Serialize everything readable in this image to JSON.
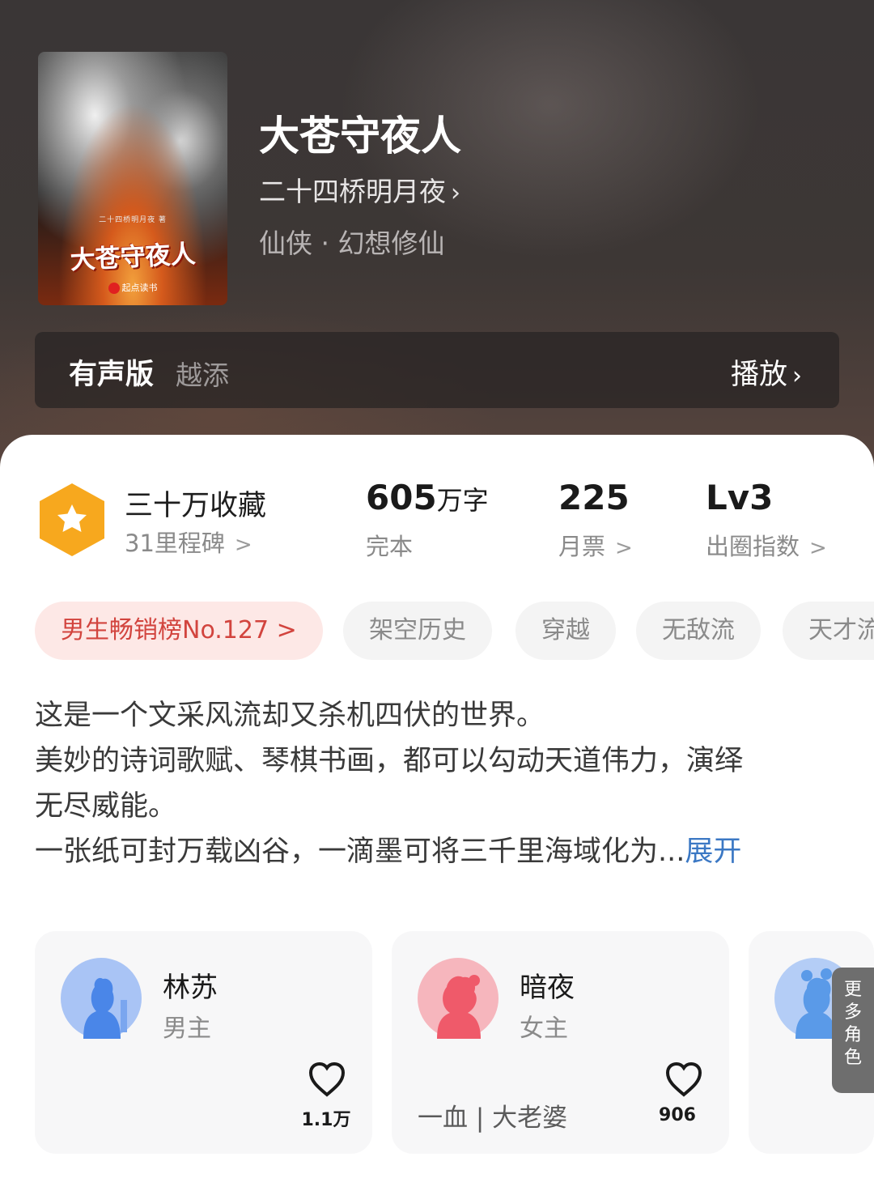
{
  "book": {
    "title": "大苍守夜人",
    "author": "二十四桥明月夜",
    "genre": "仙侠 · 幻想修仙",
    "cover": {
      "title_text": "大苍守夜人",
      "author_text": "二十四桥明月夜 著",
      "publisher_text": "起点读书"
    }
  },
  "audio": {
    "label": "有声版",
    "narrator": "越添",
    "play_label": "播放"
  },
  "stats": {
    "collection": {
      "title": "三十万收藏",
      "sub": "31里程碑"
    },
    "words": {
      "number": "605",
      "unit": "万字",
      "sub": "完本"
    },
    "monthly": {
      "number": "225",
      "sub": "月票"
    },
    "influence": {
      "number": "Lv3",
      "sub": "出圈指数"
    }
  },
  "tags": [
    {
      "label": "男生畅销榜No.127 >"
    },
    {
      "label": "架空历史"
    },
    {
      "label": "穿越"
    },
    {
      "label": "无敌流"
    },
    {
      "label": "天才流"
    }
  ],
  "description": {
    "lines": [
      "这是一个文采风流却又杀机四伏的世界。",
      "美妙的诗词歌赋、琴棋书画，都可以勾动天道伟力，演绎",
      "无尽威能。",
      "一张纸可封万载凶谷，一滴墨可将三千里海域化为..."
    ],
    "expand_label": "展开"
  },
  "roles": [
    {
      "name": "林苏",
      "type": "男主",
      "tagline": "",
      "likes": "1.1万",
      "color": "#4a86e8"
    },
    {
      "name": "暗夜",
      "type": "女主",
      "tagline": "一血 | 大老婆",
      "likes": "906",
      "color": "#ef5a6a"
    },
    {
      "name": "",
      "type": "",
      "tagline": "",
      "likes": "",
      "color": "#5a9ae8"
    }
  ],
  "more_roles": [
    "更",
    "多",
    "角",
    "色"
  ],
  "colors": {
    "accent_blue": "#3b78c4",
    "rank_red": "#d2443e",
    "hex_gold": "#f7a81e"
  }
}
